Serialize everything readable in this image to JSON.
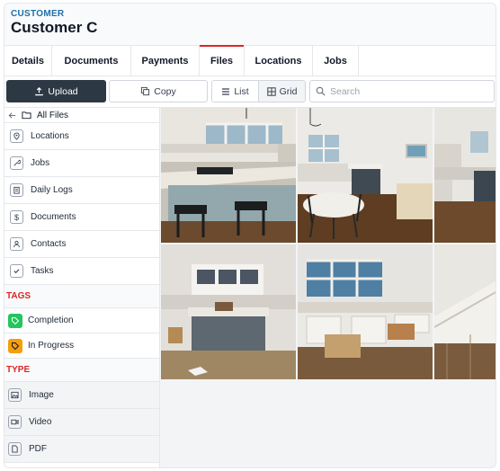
{
  "header": {
    "eyebrow": "CUSTOMER",
    "title": "Customer C"
  },
  "tabs": [
    {
      "label": "Details"
    },
    {
      "label": "Documents"
    },
    {
      "label": "Payments"
    },
    {
      "label": "Files"
    },
    {
      "label": "Locations"
    },
    {
      "label": "Jobs"
    }
  ],
  "active_tab": "Files",
  "toolbar": {
    "upload_label": "Upload",
    "copy_label": "Copy",
    "list_label": "List",
    "grid_label": "Grid",
    "search_placeholder": "Search",
    "view_mode": "Grid"
  },
  "sidebar": {
    "back_label": "All Files",
    "folders": [
      {
        "label": "Locations",
        "icon": "location-pin-icon"
      },
      {
        "label": "Jobs",
        "icon": "wrench-icon"
      },
      {
        "label": "Daily Logs",
        "icon": "clipboard-icon"
      },
      {
        "label": "Documents",
        "icon": "dollar-icon"
      },
      {
        "label": "Contacts",
        "icon": "person-icon"
      },
      {
        "label": "Tasks",
        "icon": "checkbox-icon"
      }
    ],
    "tags_heading": "TAGS",
    "tags": [
      {
        "label": "Completion",
        "color": "#22c55e"
      },
      {
        "label": "In Progress",
        "color": "#f59e0b"
      }
    ],
    "type_heading": "TYPE",
    "types": [
      {
        "label": "Image",
        "icon": "image-icon"
      },
      {
        "label": "Video",
        "icon": "video-icon"
      },
      {
        "label": "PDF",
        "icon": "pdf-icon"
      }
    ]
  },
  "colors": {
    "accent_red": "#dc2626",
    "eyebrow_blue": "#1d6fa8",
    "primary_button": "#2d3845"
  }
}
